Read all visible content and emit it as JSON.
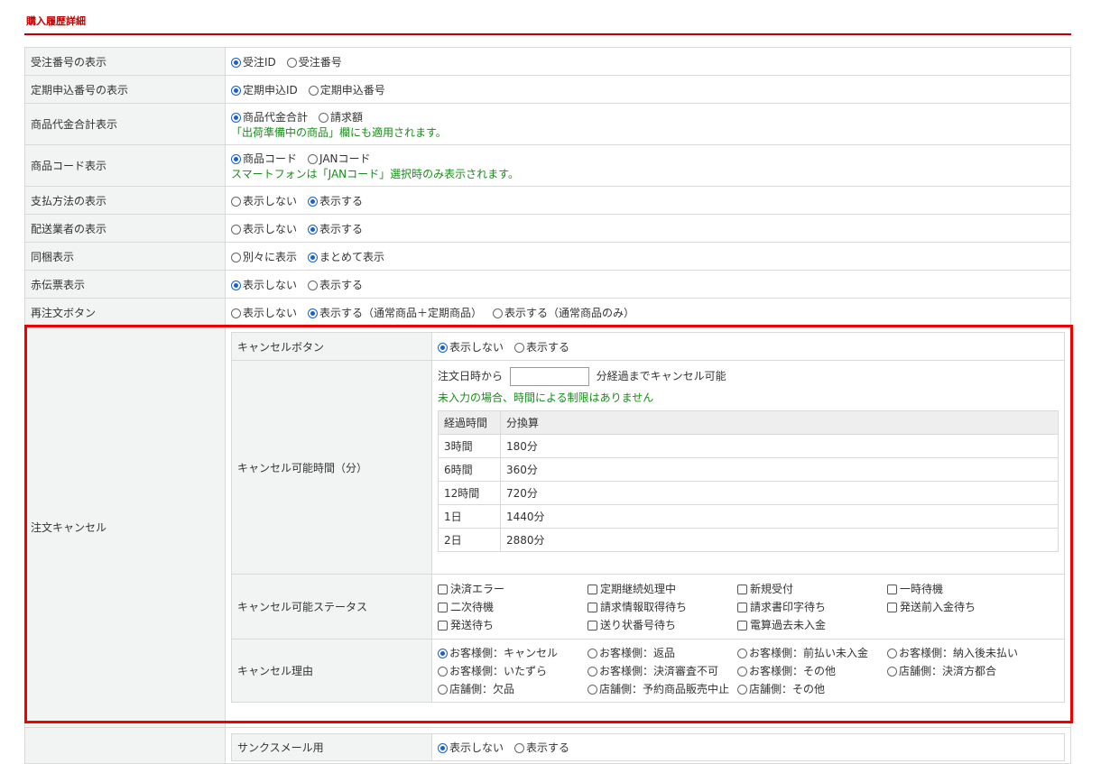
{
  "section_title": "購入履歴詳細",
  "rows": [
    {
      "label": "受注番号の表示",
      "options": [
        "受注ID",
        "受注番号"
      ],
      "selected": 0
    },
    {
      "label": "定期申込番号の表示",
      "options": [
        "定期申込ID",
        "定期申込番号"
      ],
      "selected": 0
    },
    {
      "label": "商品代金合計表示",
      "options": [
        "商品代金合計",
        "請求額"
      ],
      "selected": 0,
      "note": "「出荷準備中の商品」欄にも適用されます。"
    },
    {
      "label": "商品コード表示",
      "options": [
        "商品コード",
        "JANコード"
      ],
      "selected": 0,
      "note": "スマートフォンは「JANコード」選択時のみ表示されます。"
    },
    {
      "label": "支払方法の表示",
      "options": [
        "表示しない",
        "表示する"
      ],
      "selected": 1
    },
    {
      "label": "配送業者の表示",
      "options": [
        "表示しない",
        "表示する"
      ],
      "selected": 1
    },
    {
      "label": "同梱表示",
      "options": [
        "別々に表示",
        "まとめて表示"
      ],
      "selected": 1
    },
    {
      "label": "赤伝票表示",
      "options": [
        "表示しない",
        "表示する"
      ],
      "selected": 0
    },
    {
      "label": "再注文ボタン",
      "options": [
        "表示しない",
        "表示する（通常商品＋定期商品）",
        "表示する（通常商品のみ）"
      ],
      "selected": 1
    }
  ],
  "order_cancel": {
    "label": "注文キャンセル",
    "cancel_button": {
      "label": "キャンセルボタン",
      "options": [
        "表示しない",
        "表示する"
      ],
      "selected": 0
    },
    "cancel_time": {
      "label": "キャンセル可能時間（分）",
      "prefix": "注文日時から",
      "suffix": "分経過までキャンセル可能",
      "note": "未入力の場合、時間による制限はありません",
      "input_value": "",
      "table_headers": [
        "経過時間",
        "分換算"
      ],
      "table_rows": [
        [
          "3時間",
          "180分"
        ],
        [
          "6時間",
          "360分"
        ],
        [
          "12時間",
          "720分"
        ],
        [
          "1日",
          "1440分"
        ],
        [
          "2日",
          "2880分"
        ]
      ]
    },
    "cancel_status": {
      "label": "キャンセル可能ステータス",
      "items": [
        "決済エラー",
        "定期継続処理中",
        "新規受付",
        "一時待機",
        "二次待機",
        "請求情報取得待ち",
        "請求書印字待ち",
        "発送前入金待ち",
        "発送待ち",
        "送り状番号待ち",
        "電算過去未入金"
      ]
    },
    "cancel_reason": {
      "label": "キャンセル理由",
      "items": [
        "お客様側：キャンセル",
        "お客様側：返品",
        "お客様側：前払い未入金",
        "お客様側：納入後未払い",
        "お客様側：いたずら",
        "お客様側：決済審査不可",
        "お客様側：その他",
        "店舗側：決済方都合",
        "店舗側：欠品",
        "店舗側：予約商品販売中止",
        "店舗側：その他"
      ],
      "selected": 0
    }
  },
  "thanks_mail": {
    "label": "サンクスメール用",
    "options": [
      "表示しない",
      "表示する"
    ],
    "selected": 0
  }
}
